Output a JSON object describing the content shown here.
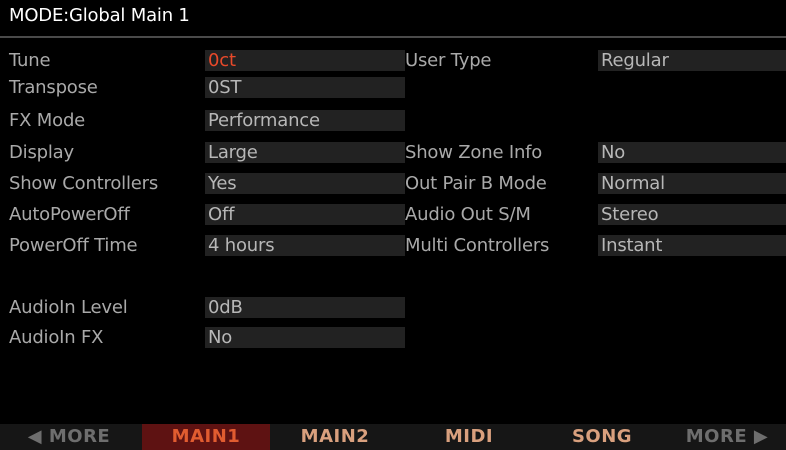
{
  "title": "MODE:Global Main 1",
  "left_params": [
    {
      "label": "Tune",
      "value": "0ct",
      "highlight": true
    },
    {
      "label": "Transpose",
      "value": "0ST"
    },
    {
      "label": "FX Mode",
      "value": "Performance"
    },
    {
      "label": "Display",
      "value": "Large"
    },
    {
      "label": "Show Controllers",
      "value": "Yes"
    },
    {
      "label": "AutoPowerOff",
      "value": "Off"
    },
    {
      "label": "PowerOff Time",
      "value": "4 hours"
    },
    {
      "label": "AudioIn Level",
      "value": "0dB"
    },
    {
      "label": "AudioIn FX",
      "value": "No"
    }
  ],
  "right_params": [
    {
      "label": "User Type",
      "value": "Regular"
    },
    {
      "label": "Show Zone Info",
      "value": "No"
    },
    {
      "label": "Out Pair B Mode",
      "value": "Normal"
    },
    {
      "label": "Audio Out S/M",
      "value": "Stereo"
    },
    {
      "label": "Multi Controllers",
      "value": "Instant"
    }
  ],
  "soft_buttons": [
    {
      "label": "◀ MORE"
    },
    {
      "label": "MAIN1",
      "active": true
    },
    {
      "label": "MAIN2"
    },
    {
      "label": "MIDI"
    },
    {
      "label": "SONG"
    },
    {
      "label": "MORE ▶"
    }
  ],
  "colors": {
    "background": "#000000",
    "label_text": "#a9a9a9",
    "value_text": "#b7b7b7",
    "value_box": "#222222",
    "selected_value": "#e8492a",
    "active_tab_bg": "#5e1212",
    "active_tab_text": "#e15c30",
    "tab_text": "#d9a07e"
  }
}
